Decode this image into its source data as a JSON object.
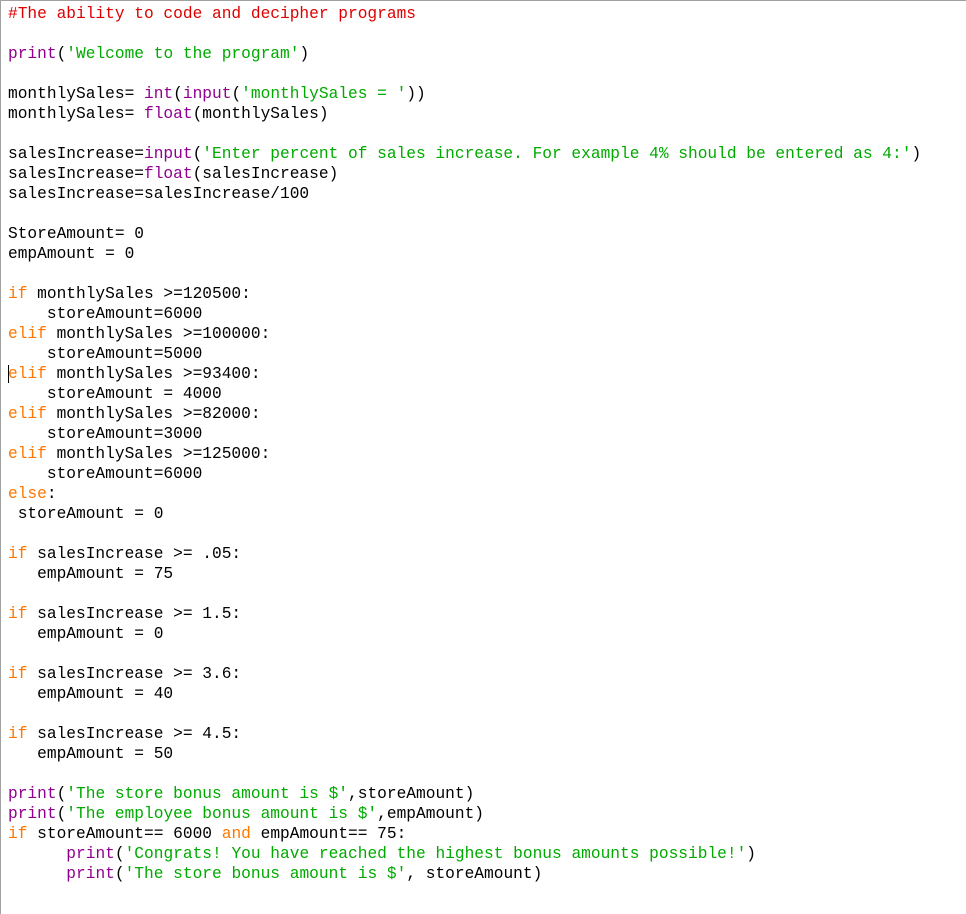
{
  "editor": {
    "colors": {
      "comment": "#dd0000",
      "keyword": "#ff7700",
      "builtin": "#900090",
      "string": "#00aa00",
      "default": "#000000"
    },
    "caret": {
      "line": 18,
      "col": 0
    },
    "lines": [
      [
        [
          "comment",
          "#The ability to code and decipher programs"
        ]
      ],
      [],
      [
        [
          "builtin",
          "print"
        ],
        [
          "default",
          "("
        ],
        [
          "string",
          "'Welcome to the program'"
        ],
        [
          "default",
          ")"
        ]
      ],
      [],
      [
        [
          "default",
          "monthlySales= "
        ],
        [
          "builtin",
          "int"
        ],
        [
          "default",
          "("
        ],
        [
          "builtin",
          "input"
        ],
        [
          "default",
          "("
        ],
        [
          "string",
          "'monthlySales = '"
        ],
        [
          "default",
          "))"
        ]
      ],
      [
        [
          "default",
          "monthlySales= "
        ],
        [
          "builtin",
          "float"
        ],
        [
          "default",
          "(monthlySales)"
        ]
      ],
      [],
      [
        [
          "default",
          "salesIncrease="
        ],
        [
          "builtin",
          "input"
        ],
        [
          "default",
          "("
        ],
        [
          "string",
          "'Enter percent of sales increase. For example 4% should be entered as 4:'"
        ],
        [
          "default",
          ")"
        ]
      ],
      [
        [
          "default",
          "salesIncrease="
        ],
        [
          "builtin",
          "float"
        ],
        [
          "default",
          "(salesIncrease)"
        ]
      ],
      [
        [
          "default",
          "salesIncrease=salesIncrease/100"
        ]
      ],
      [],
      [
        [
          "default",
          "StoreAmount= 0"
        ]
      ],
      [
        [
          "default",
          "empAmount = 0"
        ]
      ],
      [],
      [
        [
          "keyword",
          "if"
        ],
        [
          "default",
          " monthlySales >=120500:"
        ]
      ],
      [
        [
          "default",
          "    storeAmount=6000"
        ]
      ],
      [
        [
          "keyword",
          "elif"
        ],
        [
          "default",
          " monthlySales >=100000:"
        ]
      ],
      [
        [
          "default",
          "    storeAmount=5000"
        ]
      ],
      [
        [
          "keyword",
          "elif"
        ],
        [
          "default",
          " monthlySales >=93400:"
        ]
      ],
      [
        [
          "default",
          "    storeAmount = 4000"
        ]
      ],
      [
        [
          "keyword",
          "elif"
        ],
        [
          "default",
          " monthlySales >=82000:"
        ]
      ],
      [
        [
          "default",
          "    storeAmount=3000"
        ]
      ],
      [
        [
          "keyword",
          "elif"
        ],
        [
          "default",
          " monthlySales >=125000:"
        ]
      ],
      [
        [
          "default",
          "    storeAmount=6000"
        ]
      ],
      [
        [
          "keyword",
          "else"
        ],
        [
          "default",
          ":"
        ]
      ],
      [
        [
          "default",
          " storeAmount = 0"
        ]
      ],
      [],
      [
        [
          "keyword",
          "if"
        ],
        [
          "default",
          " salesIncrease >= .05:"
        ]
      ],
      [
        [
          "default",
          "   empAmount = 75"
        ]
      ],
      [],
      [
        [
          "keyword",
          "if"
        ],
        [
          "default",
          " salesIncrease >= 1.5:"
        ]
      ],
      [
        [
          "default",
          "   empAmount = 0"
        ]
      ],
      [],
      [
        [
          "keyword",
          "if"
        ],
        [
          "default",
          " salesIncrease >= 3.6:"
        ]
      ],
      [
        [
          "default",
          "   empAmount = 40"
        ]
      ],
      [],
      [
        [
          "keyword",
          "if"
        ],
        [
          "default",
          " salesIncrease >= 4.5:"
        ]
      ],
      [
        [
          "default",
          "   empAmount = 50"
        ]
      ],
      [],
      [
        [
          "builtin",
          "print"
        ],
        [
          "default",
          "("
        ],
        [
          "string",
          "'The store bonus amount is $'"
        ],
        [
          "default",
          ",storeAmount)"
        ]
      ],
      [
        [
          "builtin",
          "print"
        ],
        [
          "default",
          "("
        ],
        [
          "string",
          "'The employee bonus amount is $'"
        ],
        [
          "default",
          ",empAmount)"
        ]
      ],
      [
        [
          "keyword",
          "if"
        ],
        [
          "default",
          " storeAmount== 6000 "
        ],
        [
          "keyword",
          "and"
        ],
        [
          "default",
          " empAmount== 75:"
        ]
      ],
      [
        [
          "default",
          "      "
        ],
        [
          "builtin",
          "print"
        ],
        [
          "default",
          "("
        ],
        [
          "string",
          "'Congrats! You have reached the highest bonus amounts possible!'"
        ],
        [
          "default",
          ")"
        ]
      ],
      [
        [
          "default",
          "      "
        ],
        [
          "builtin",
          "print"
        ],
        [
          "default",
          "("
        ],
        [
          "string",
          "'The store bonus amount is $'"
        ],
        [
          "default",
          ", storeAmount)"
        ]
      ]
    ]
  }
}
